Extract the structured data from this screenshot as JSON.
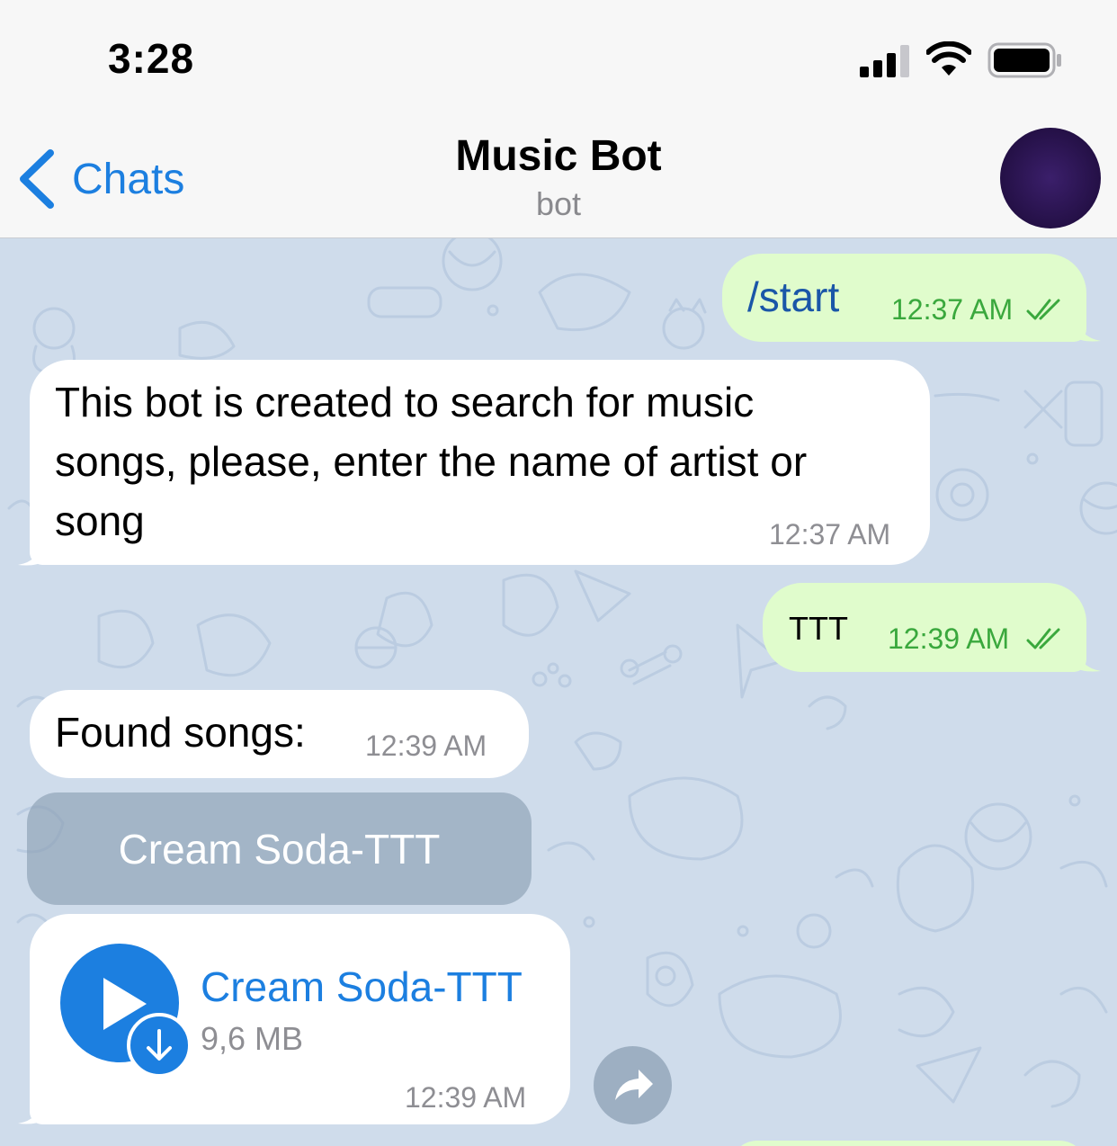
{
  "status_bar": {
    "time": "3:28",
    "icons": [
      "signal-icon",
      "wifi-icon",
      "battery-icon"
    ]
  },
  "nav": {
    "back_label": "Chats",
    "title": "Music Bot",
    "subtitle": "bot",
    "back_icon": "chevron-left-icon"
  },
  "colors": {
    "accent": "#1c7fe0",
    "outgoing_bubble": "#e0fccc",
    "incoming_bubble": "#ffffff",
    "chat_background": "#cfdceb",
    "outgoing_time": "#3aa83d"
  },
  "messages": [
    {
      "direction": "out",
      "text": "/start",
      "time": "12:37 AM",
      "status": "read"
    },
    {
      "direction": "in",
      "lines": [
        "This bot is created to search for music",
        "songs, please, enter the name of artist or",
        "song"
      ],
      "time": "12:37 AM"
    },
    {
      "direction": "out",
      "text": "TTT",
      "time": "12:39 AM",
      "status": "read"
    },
    {
      "direction": "in",
      "text": "Found songs:",
      "time": "12:39 AM"
    },
    {
      "direction": "in",
      "type": "audio",
      "title": "Cream Soda-TTT",
      "size": "9,6 MB",
      "time": "12:39 AM"
    }
  ],
  "inline_keyboard": {
    "buttons": [
      {
        "label": "Cream Soda-TTT"
      }
    ]
  }
}
